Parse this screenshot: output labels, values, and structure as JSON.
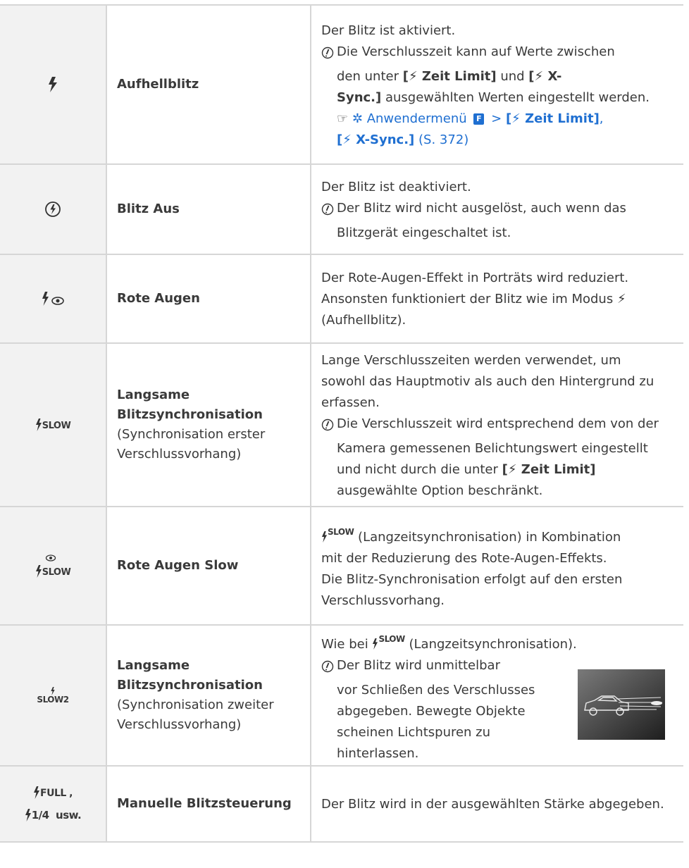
{
  "rows": [
    {
      "symbol": "Flash-Symbol (Aufhellblitz)",
      "name": "Aufhellblitz",
      "line1": "Der Blitz ist aktiviert.",
      "note_a": "Die Verschlusszeit kann auf Werte zwischen",
      "note_b": "den unter",
      "note_c": "Zeit Limit]",
      "note_d": "und",
      "note_e": "X-",
      "note_f": "Sync.]",
      "note_g": "ausgewählten Werten eingestellt werden.",
      "ref_menu": "Anwendermenü",
      "ref_box": "F",
      "ref_gt": ">",
      "ref_time": "Zeit Limit]",
      "ref_comma": ",",
      "ref_sync": "X-Sync.]",
      "ref_page": "(S. 372)"
    },
    {
      "name": "Blitz Aus",
      "line1": "Der Blitz ist deaktiviert.",
      "note_a": "Der Blitz wird nicht ausgelöst, auch wenn das",
      "note_b": "Blitzgerät eingeschaltet ist."
    },
    {
      "name": "Rote Augen",
      "line1": "Der Rote-Augen-Effekt in Porträts wird reduziert.",
      "line2": "Ansonsten funktioniert der Blitz wie im Modus",
      "line3": "(Aufhellblitz)."
    },
    {
      "name_a": "Langsame",
      "name_b": "Blitzsynchronisation",
      "sub_a": "(Synchronisation erster",
      "sub_b": "Verschlussvorhang)",
      "line1": "Lange Verschlusszeiten werden verwendet, um",
      "line2": "sowohl das Hauptmotiv als auch den Hintergrund zu",
      "line3": "erfassen.",
      "note_a": "Die Verschlusszeit wird entsprechend dem von der",
      "note_b": "Kamera gemessenen Belichtungswert eingestellt",
      "note_c": "und nicht durch die unter",
      "note_d": "Zeit Limit]",
      "note_e": "ausgewählte Option beschränkt.",
      "slow_label": "SLOW"
    },
    {
      "name": "Rote Augen Slow",
      "slow_label": "SLOW",
      "line1": "(Langzeitsynchronisation) in Kombination",
      "line2": "mit der Reduzierung des Rote-Augen-Effekts.",
      "line3": "Die Blitz-Synchronisation erfolgt auf den ersten",
      "line4": "Verschlussvorhang."
    },
    {
      "name_a": "Langsame",
      "name_b": "Blitzsynchronisation",
      "sub_a": "(Synchronisation zweiter",
      "sub_b": "Verschlussvorhang)",
      "slow2_label": "SLOW2",
      "line1_a": "Wie bei",
      "line1_b": "(Langzeitsynchronisation).",
      "note_a": "Der Blitz wird unmittelbar",
      "note_b": "vor Schließen des Verschlusses",
      "note_c": "abgegeben. Bewegte Objekte",
      "note_d": "scheinen Lichtspuren zu",
      "note_e": "hinterlassen."
    },
    {
      "name": "Manuelle Blitzsteuerung",
      "sym_full": "FULL ,",
      "sym_quarter": "1/4  usw.",
      "line1": "Der Blitz wird in der ausgewählten Stärke abgegeben."
    }
  ],
  "colors": {
    "link": "#1f6fd1",
    "border": "#d6d6d6",
    "symbol_bg": "#f2f2f2",
    "text": "#3a3a3a"
  }
}
